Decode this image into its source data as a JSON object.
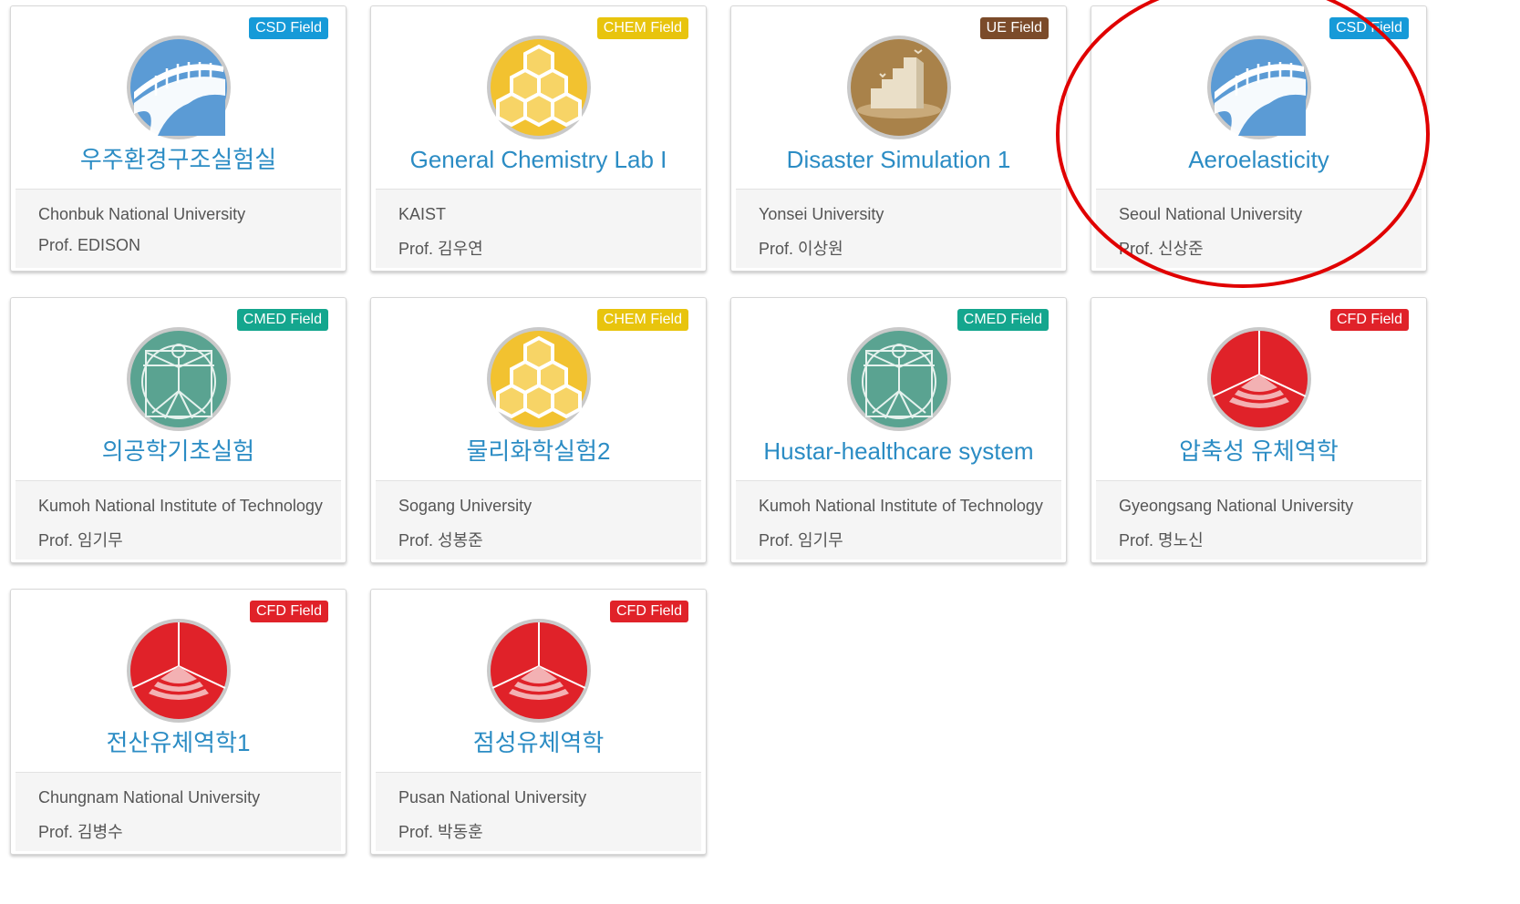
{
  "field_colors": {
    "CSD": "#169ad8",
    "CHEM": "#e8c40d",
    "UE": "#7b4b2a",
    "CMED": "#14a68e",
    "CFD": "#e02229"
  },
  "highlight_color": "#e00000",
  "cards": [
    {
      "title": "우주환경구조실험실",
      "university": "Chonbuk National University",
      "professor": "Prof. EDISON",
      "badge": "CSD Field",
      "field": "CSD",
      "icon": "bridge-icon"
    },
    {
      "title": "General Chemistry Lab I",
      "university": "KAIST",
      "professor": "Prof. 김우연",
      "badge": "CHEM Field",
      "field": "CHEM",
      "icon": "hexagon-icon"
    },
    {
      "title": "Disaster Simulation 1",
      "university": "Yonsei University",
      "professor": "Prof. 이상원",
      "badge": "UE Field",
      "field": "UE",
      "icon": "city-icon"
    },
    {
      "title": "Aeroelasticity",
      "university": "Seoul National University",
      "professor": "Prof. 신상준",
      "badge": "CSD Field",
      "field": "CSD",
      "icon": "bridge-icon"
    },
    {
      "title": "의공학기초실험",
      "university": "Kumoh National Institute of Technology",
      "professor": "Prof. 임기무",
      "badge": "CMED Field",
      "field": "CMED",
      "icon": "vitruvian-icon"
    },
    {
      "title": "물리화학실험2",
      "university": "Sogang University",
      "professor": "Prof. 성봉준",
      "badge": "CHEM Field",
      "field": "CHEM",
      "icon": "hexagon-icon"
    },
    {
      "title": "Hustar-healthcare system",
      "university": "Kumoh National Institute of Technology",
      "professor": "Prof. 임기무",
      "badge": "CMED Field",
      "field": "CMED",
      "icon": "vitruvian-icon"
    },
    {
      "title": "압축성 유체역학",
      "university": "Gyeongsang National University",
      "professor": "Prof. 명노신",
      "badge": "CFD Field",
      "field": "CFD",
      "icon": "wave-icon"
    },
    {
      "title": "전산유체역학1",
      "university": "Chungnam National University",
      "professor": "Prof. 김병수",
      "badge": "CFD Field",
      "field": "CFD",
      "icon": "wave-icon"
    },
    {
      "title": "점성유체역학",
      "university": "Pusan National University",
      "professor": "Prof. 박동훈",
      "badge": "CFD Field",
      "field": "CFD",
      "icon": "wave-icon"
    }
  ]
}
